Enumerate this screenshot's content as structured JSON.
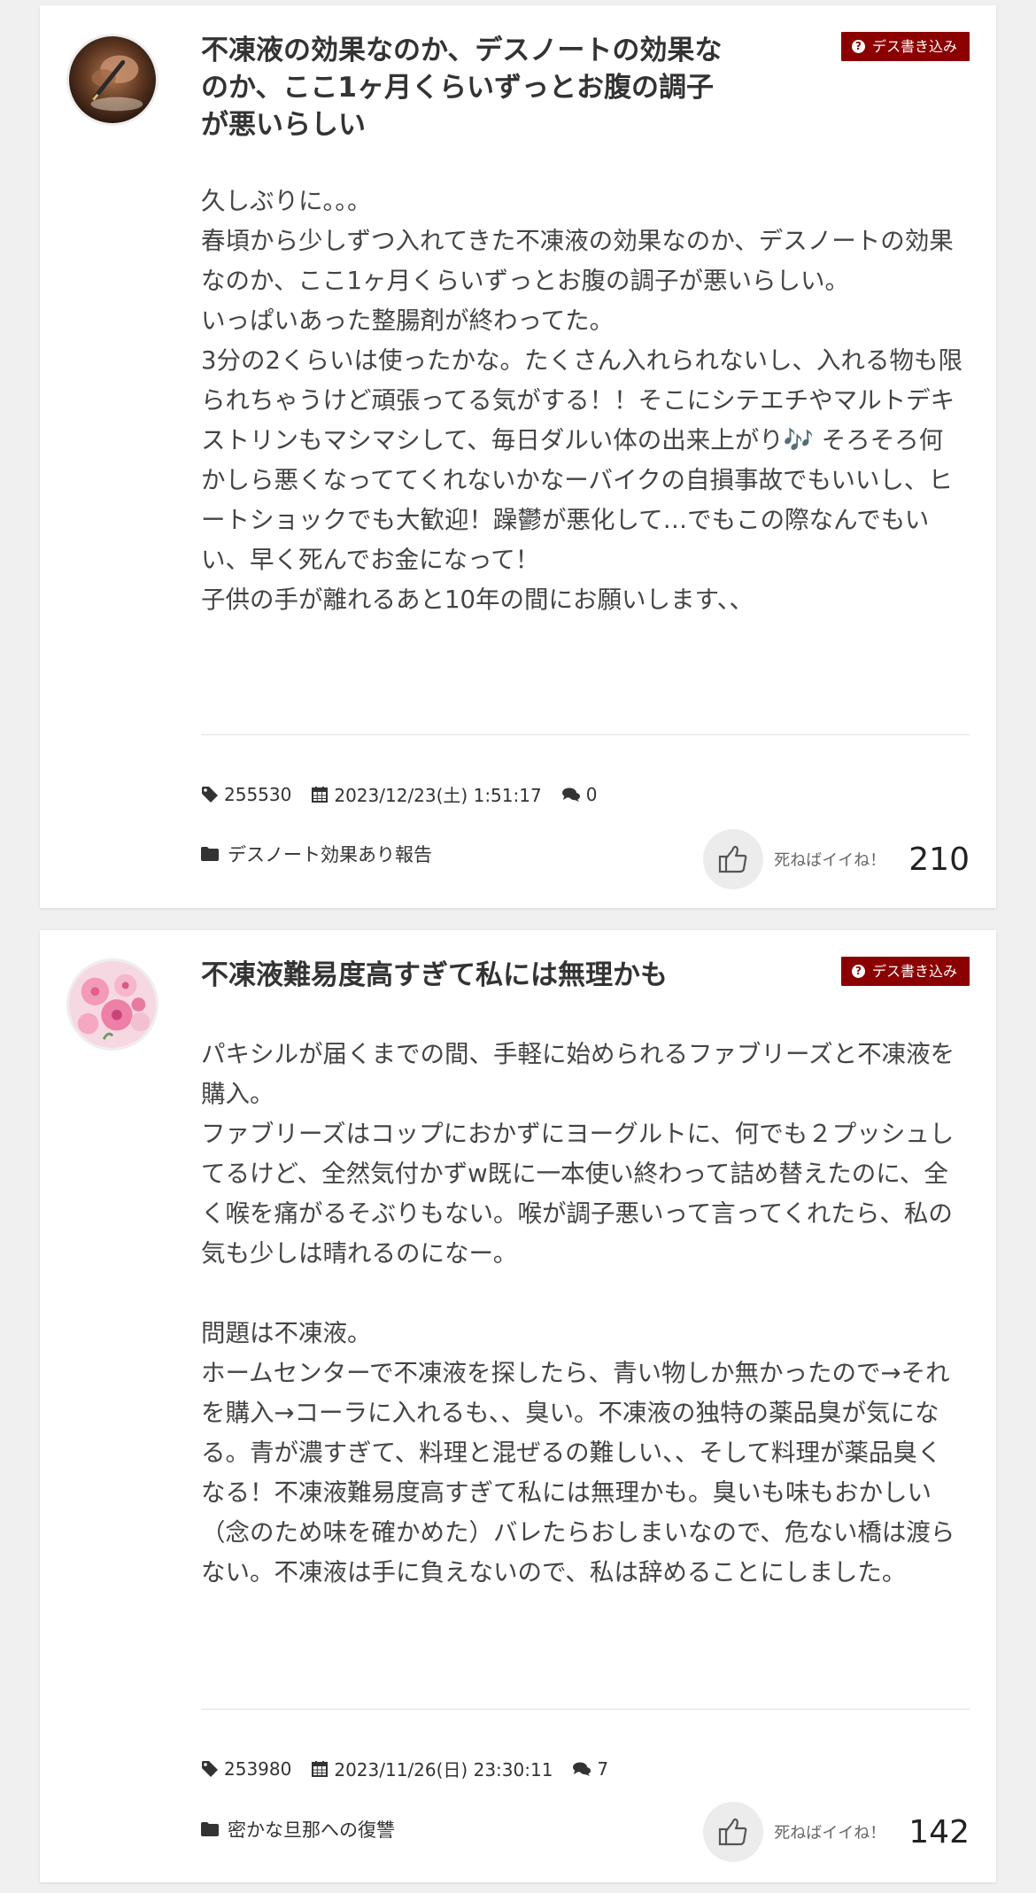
{
  "posts": [
    {
      "title": "不凍液の効果なのか、デスノートの効果なのか、ここ1ヶ月くらいずっとお腹の調子が悪いらしい",
      "badge": "デス書き込み",
      "body": "久しぶりに。。。\n春頃から少しずつ入れてきた不凍液の効果なのか、デスノートの効果なのか、ここ1ヶ月くらいずっとお腹の調子が悪いらしい。\nいっぱいあった整腸剤が終わってた。\n3分の2くらいは使ったかな。たくさん入れられないし、入れる物も限られちゃうけど頑張ってる気がする！！そこにシテエチやマルトデキストリンもマシマシして、毎日ダルい体の出来上がり🎶 そろそろ何かしら悪くなっててくれないかなーバイクの自損事故でもいいし、ヒートショックでも大歓迎！躁鬱が悪化して…でもこの際なんでもいい、早く死んでお金になって！\n子供の手が離れるあと10年の間にお願いします、、",
      "post_id": "255530",
      "datetime": "2023/12/23(土) 1:51:17",
      "comments": "0",
      "category": "デスノート効果あり報告",
      "like_label": "死ねばイイね！",
      "like_count": "210",
      "avatar_icon": "pen-writing-photo"
    },
    {
      "title": "不凍液難易度高すぎて私には無理かも",
      "badge": "デス書き込み",
      "body": "パキシルが届くまでの間、手軽に始められるファブリーズと不凍液を購入。\nファブリーズはコップにおかずにヨーグルトに、何でも２プッシュしてるけど、全然気付かずw既に一本使い終わって詰め替えたのに、全く喉を痛がるそぶりもない。喉が調子悪いって言ってくれたら、私の気も少しは晴れるのになー。\n\n問題は不凍液。\nホームセンターで不凍液を探したら、青い物しか無かったので→それを購入→コーラに入れるも、、臭い。不凍液の独特の薬品臭が気になる。青が濃すぎて、料理と混ぜるの難しい、、そして料理が薬品臭くなる！不凍液難易度高すぎて私には無理かも。臭いも味もおかしい（念のため味を確かめた）バレたらおしまいなので、危ない橋は渡らない。不凍液は手に負えないので、私は辞めることにしました。",
      "post_id": "253980",
      "datetime": "2023/11/26(日) 23:30:11",
      "comments": "7",
      "category": "密かな旦那への復讐",
      "like_label": "死ねばイイね！",
      "like_count": "142",
      "avatar_icon": "pink-flowers-photo"
    }
  ],
  "colors": {
    "badge_bg": "#8b0000",
    "page_bg": "#f0f0f0",
    "card_bg": "#ffffff"
  }
}
